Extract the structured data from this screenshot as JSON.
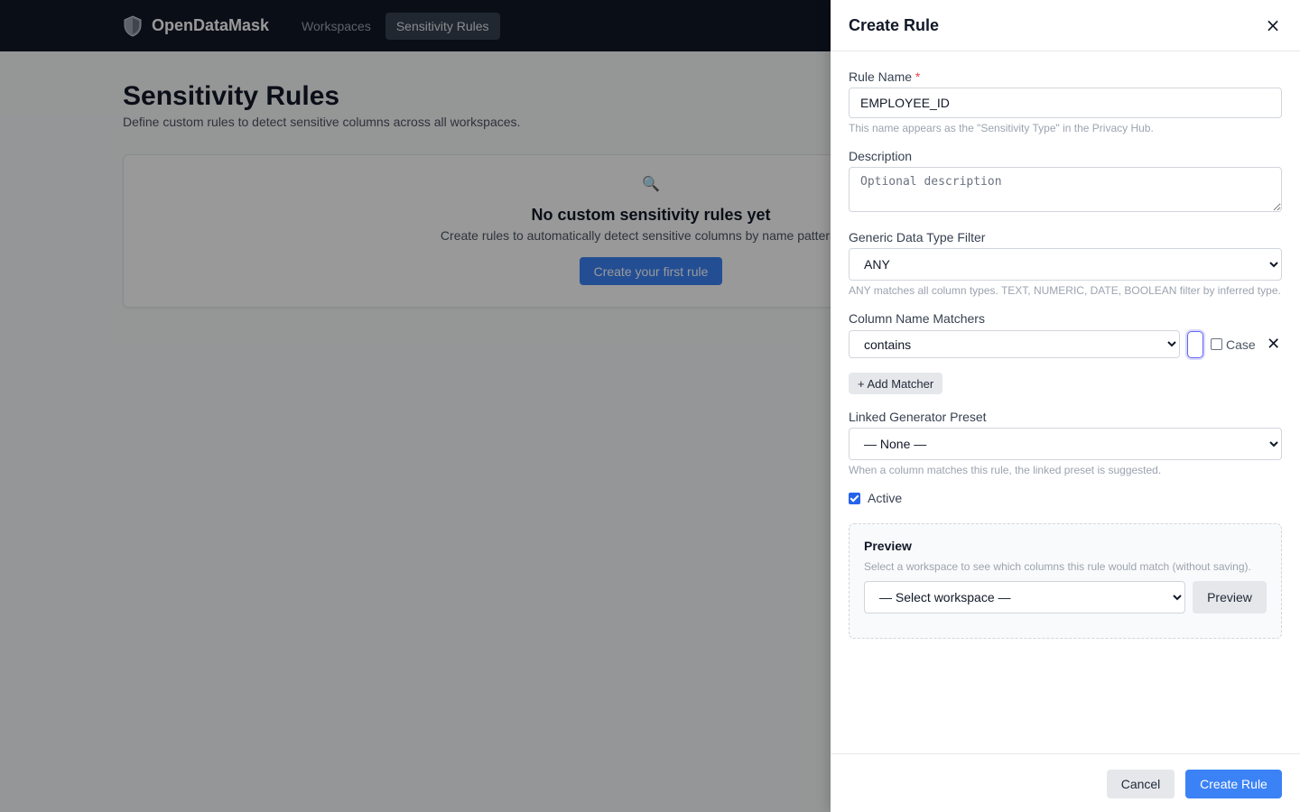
{
  "nav": {
    "brand": "OpenDataMask",
    "brand_icon": "shield-icon",
    "links": [
      "Workspaces",
      "Sensitivity Rules"
    ],
    "active": "Sensitivity Rules"
  },
  "page": {
    "title": "Sensitivity Rules",
    "subtitle": "Define custom rules to detect sensitive columns across all workspaces.",
    "empty_icon": "🔍",
    "empty_title": "No custom sensitivity rules yet",
    "empty_desc": "Create rules to automatically detect sensitive columns by name pattern and",
    "empty_button": "Create your first rule"
  },
  "drawer": {
    "title": "Create Rule",
    "close_glyph": "×",
    "rule_name": {
      "label": "Rule Name",
      "required_mark": "*",
      "value": "EMPLOYEE_ID",
      "hint": "This name appears as the \"Sensitivity Type\" in the Privacy Hub."
    },
    "description": {
      "label": "Description",
      "placeholder": "Optional description"
    },
    "data_type": {
      "label": "Generic Data Type Filter",
      "value": "ANY",
      "hint": "ANY matches all column types. TEXT, NUMERIC, DATE, BOOLEAN filter by inferred type."
    },
    "matchers": {
      "label": "Column Name Matchers",
      "operator": "contains",
      "case_label": "Case",
      "case_checked": false,
      "remove_glyph": "✕",
      "add_button": "+ Add Matcher"
    },
    "preset": {
      "label": "Linked Generator Preset",
      "value": "— None —",
      "hint": "When a column matches this rule, the linked preset is suggested."
    },
    "active": {
      "label": "Active",
      "checked": true
    },
    "preview": {
      "title": "Preview",
      "hint": "Select a workspace to see which columns this rule would match (without saving).",
      "workspace_value": "— Select workspace —",
      "button": "Preview"
    },
    "footer": {
      "cancel": "Cancel",
      "create": "Create Rule"
    }
  },
  "colors": {
    "nav_bg": "#111827",
    "primary": "#3b82f6",
    "required": "#ef4444"
  }
}
